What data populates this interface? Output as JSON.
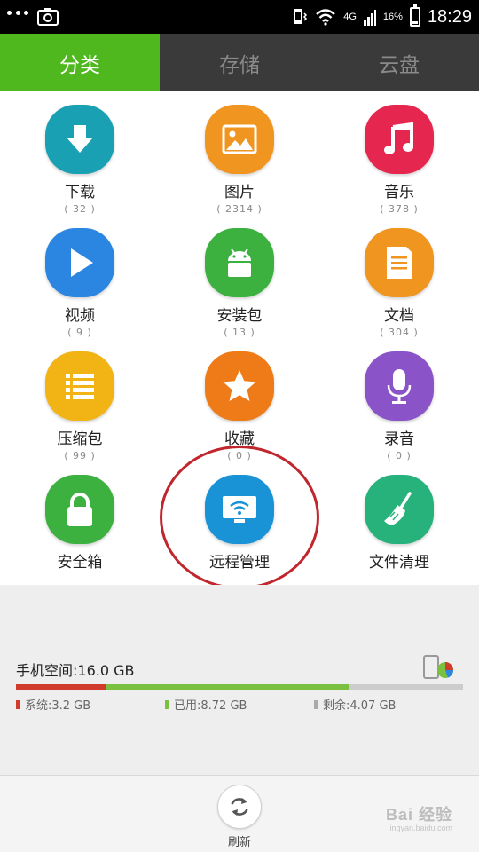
{
  "status_bar": {
    "network": "4G",
    "battery": "16%",
    "battery_level": 0.16,
    "time": "18:29"
  },
  "tabs": [
    {
      "label": "分类",
      "active": true
    },
    {
      "label": "存储",
      "active": false
    },
    {
      "label": "云盘",
      "active": false
    }
  ],
  "categories": [
    {
      "label": "下载",
      "count": "( 32 )",
      "icon": "download-icon",
      "color": "#1aa0b3"
    },
    {
      "label": "图片",
      "count": "( 2314 )",
      "icon": "picture-icon",
      "color": "#f0951f"
    },
    {
      "label": "音乐",
      "count": "( 378 )",
      "icon": "music-icon",
      "color": "#e5264f"
    },
    {
      "label": "视频",
      "count": "( 9 )",
      "icon": "video-icon",
      "color": "#2a86e0"
    },
    {
      "label": "安装包",
      "count": "( 13 )",
      "icon": "android-icon",
      "color": "#3cb13f"
    },
    {
      "label": "文档",
      "count": "( 304 )",
      "icon": "document-icon",
      "color": "#f0951f"
    },
    {
      "label": "压缩包",
      "count": "( 99 )",
      "icon": "archive-icon",
      "color": "#f2b315"
    },
    {
      "label": "收藏",
      "count": "( 0 )",
      "icon": "star-icon",
      "color": "#ee7b18"
    },
    {
      "label": "录音",
      "count": "( 0 )",
      "icon": "microphone-icon",
      "color": "#8a53c8"
    },
    {
      "label": "安全箱",
      "count": "",
      "icon": "lock-icon",
      "color": "#3cb13f"
    },
    {
      "label": "远程管理",
      "count": "",
      "icon": "monitor-wifi-icon",
      "color": "#1a93d6"
    },
    {
      "label": "文件清理",
      "count": "",
      "icon": "broom-icon",
      "color": "#27b27c"
    }
  ],
  "storage": {
    "title": "手机空间:16.0 GB",
    "segments": [
      {
        "label": "系统:3.2 GB",
        "fraction": 0.2,
        "color": "#d13b2b"
      },
      {
        "label": "已用:8.72 GB",
        "fraction": 0.545,
        "color": "#7ac142"
      },
      {
        "label": "剩余:4.07 GB",
        "fraction": 0.255,
        "color": "#cccccc"
      }
    ]
  },
  "bottom": {
    "refresh_label": "刷新",
    "watermark": "Bai 经验",
    "watermark_sub": "jingyan.baidu.com"
  }
}
